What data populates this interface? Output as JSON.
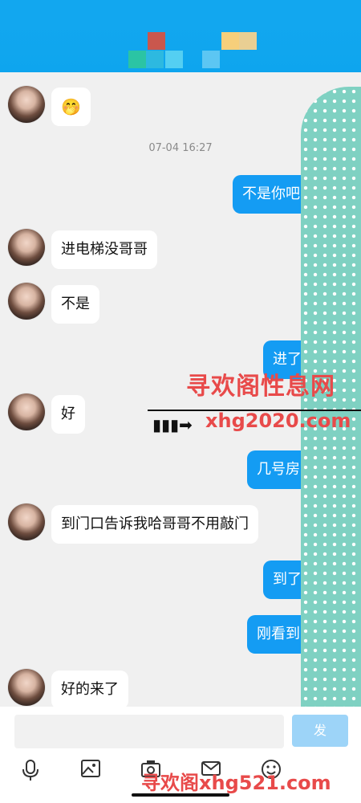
{
  "status": {
    "time": ""
  },
  "header": {
    "title": ""
  },
  "chat": {
    "timestamp": "07-04 16:27",
    "messages": [
      {
        "side": "left",
        "text": "🤭"
      },
      {
        "side": "right",
        "text": "不是你吧"
      },
      {
        "side": "left",
        "text": "进电梯没哥哥"
      },
      {
        "side": "left",
        "text": "不是"
      },
      {
        "side": "right",
        "text": "进了"
      },
      {
        "side": "left",
        "text": "好"
      },
      {
        "side": "right",
        "text": "几号房"
      },
      {
        "side": "left",
        "text": "到门口告诉我哈哥哥不用敲门"
      },
      {
        "side": "right",
        "text": "到了"
      },
      {
        "side": "right",
        "text": "刚看到"
      },
      {
        "side": "left",
        "text": "好的来了"
      }
    ]
  },
  "watermark": {
    "cn": "寻欢阁性息网",
    "url": "xhg2020.com",
    "bottom": "寻欢阁xhg521.com"
  },
  "input": {
    "placeholder": "",
    "send_label": "发"
  },
  "toolbar": {
    "icons": [
      "microphone-icon",
      "image-icon",
      "camera-icon",
      "mail-icon",
      "emoji-icon"
    ]
  },
  "colors": {
    "header": "#12a7ef",
    "bubble_right": "#149cf3",
    "bubble_left": "#ffffff",
    "watermark": "#e84a4a"
  }
}
